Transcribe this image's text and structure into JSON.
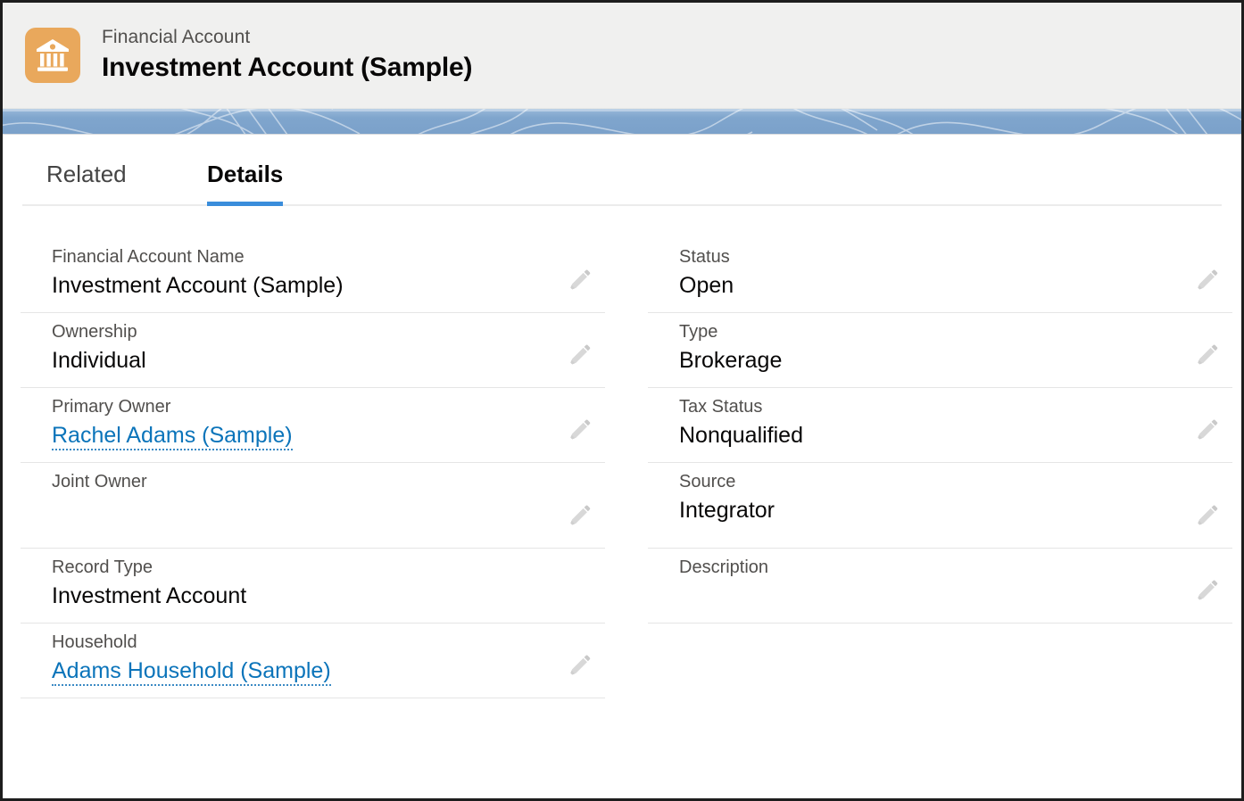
{
  "header": {
    "entity_type": "Financial Account",
    "record_title": "Investment Account (Sample)",
    "icon": "bank-icon",
    "icon_color": "#e9a85c"
  },
  "band": {
    "color": "#7ba1ca"
  },
  "tabs": [
    {
      "label": "Related",
      "active": false
    },
    {
      "label": "Details",
      "active": true
    }
  ],
  "accent_color": "#3a8ddb",
  "link_color": "#0b74ba",
  "details": {
    "left_column": [
      {
        "label": "Financial Account Name",
        "value": "Investment Account (Sample)",
        "is_link": false,
        "editable": true
      },
      {
        "label": "Ownership",
        "value": "Individual",
        "is_link": false,
        "editable": true
      },
      {
        "label": "Primary Owner",
        "value": "Rachel Adams (Sample)",
        "is_link": true,
        "editable": true
      },
      {
        "label": "Joint Owner",
        "value": "",
        "is_link": false,
        "editable": true
      },
      {
        "label": "Record Type",
        "value": "Investment Account",
        "is_link": false,
        "editable": false
      },
      {
        "label": "Household",
        "value": "Adams Household (Sample)",
        "is_link": true,
        "editable": true
      }
    ],
    "right_column": [
      {
        "label": "Status",
        "value": "Open",
        "is_link": false,
        "editable": true
      },
      {
        "label": "Type",
        "value": "Brokerage",
        "is_link": false,
        "editable": true
      },
      {
        "label": "Tax Status",
        "value": "Nonqualified",
        "is_link": false,
        "editable": true
      },
      {
        "label": "Source",
        "value": "Integrator",
        "is_link": false,
        "editable": true
      },
      {
        "label": "Description",
        "value": "",
        "is_link": false,
        "editable": true
      }
    ]
  }
}
